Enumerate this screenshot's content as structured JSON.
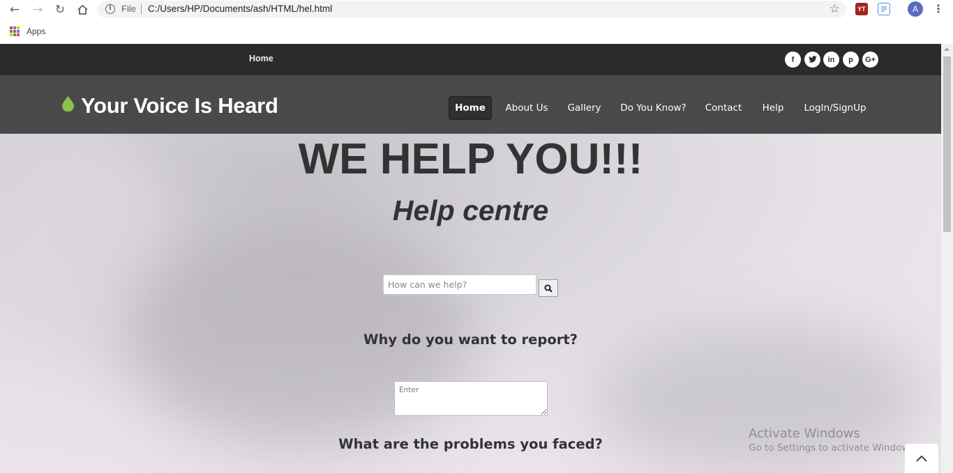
{
  "browser": {
    "file_label": "File",
    "url": "C:/Users/HP/Documents/ash/HTML/hel.html",
    "bookmarks": {
      "apps_label": "Apps"
    },
    "avatar_letter": "A",
    "extensions": [
      {
        "name": "youtube-extension-icon",
        "label": "YT",
        "color": "#cc181e"
      },
      {
        "name": "notes-extension-icon",
        "label": "",
        "color": "#4a90d9"
      }
    ]
  },
  "site": {
    "topbar": {
      "home_link": "Home",
      "social_icons": [
        "f",
        "t",
        "in",
        "p",
        "G+"
      ]
    },
    "brand": "Your Voice Is Heard",
    "brand_color": "#8bc34a",
    "nav": [
      {
        "label": "Home",
        "active": true
      },
      {
        "label": "About Us",
        "active": false
      },
      {
        "label": "Gallery",
        "active": false
      },
      {
        "label": "Do You Know?",
        "active": false
      },
      {
        "label": "Contact",
        "active": false
      },
      {
        "label": "Help",
        "active": false
      },
      {
        "label": "LogIn/SignUp",
        "active": false
      }
    ]
  },
  "main": {
    "title": "WE HELP YOU!!!",
    "subtitle": "Help centre",
    "search": {
      "placeholder": "How can we help?",
      "value": ""
    },
    "question1": "Why do you want to report?",
    "report": {
      "placeholder": "Enter",
      "value": ""
    },
    "question2": "What are the problems you faced?"
  },
  "os_overlay": {
    "activate_title": "Activate Windows",
    "activate_subtitle": "Go to Settings to activate Windows."
  }
}
